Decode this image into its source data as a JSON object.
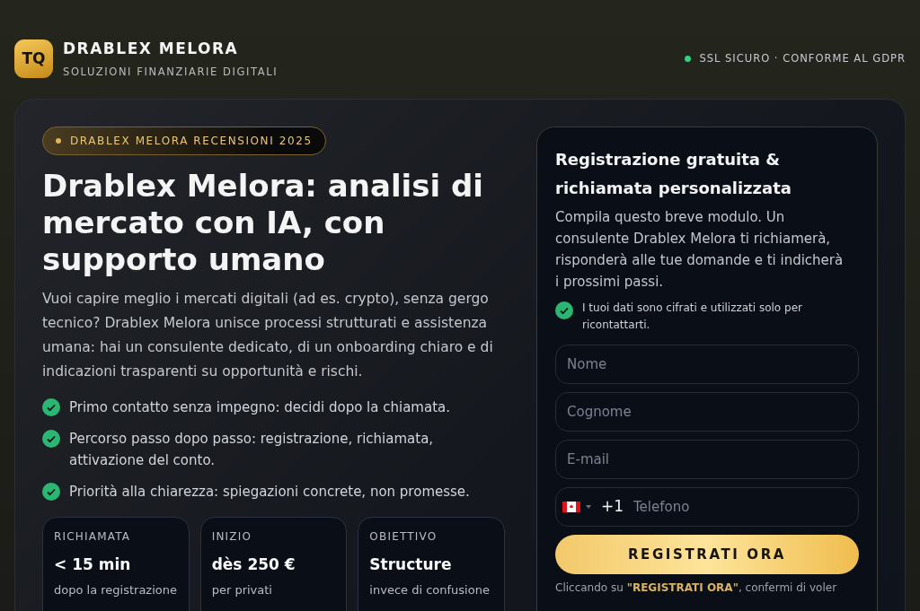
{
  "brand": {
    "logo": "TQ",
    "name": "DRABLEX MELORA",
    "tagline": "SOLUZIONI FINANZIARIE DIGITALI"
  },
  "security": {
    "text": "SSL SICURO · CONFORME AL GDPR"
  },
  "hero": {
    "badge": "DRABLEX MELORA RECENSIONI 2025",
    "title": "Drablex Melora: analisi di mercato con IA, con supporto umano",
    "intro": "Vuoi capire meglio i mercati digitali (ad es. crypto), senza gergo tecnico? Drablex Melora unisce processi strutturati e assistenza umana: hai un consulente dedicato, di un onboarding chiaro e di indicazioni trasparenti su opportunità e rischi.",
    "benefits": [
      "Primo contatto senza impegno: decidi dopo la chiamata.",
      "Percorso passo dopo passo: registrazione, richiamata, attivazione del conto.",
      "Priorità alla chiarezza: spiegazioni concrete, non promesse."
    ],
    "stats": [
      {
        "label": "RICHIAMATA",
        "value": "< 15 min",
        "note": "dopo la registrazione"
      },
      {
        "label": "INIZIO",
        "value": "dès 250 €",
        "note": "per privati"
      },
      {
        "label": "OBIETTIVO",
        "value": "Structure",
        "note": "invece di confusione"
      }
    ]
  },
  "form": {
    "title": "Registrazione gratuita & richiamata personalizzata",
    "description": "Compila questo breve modulo. Un consulente Drablex Melora ti richiamerà, risponderà alle tue domande e ti indicherà i prossimi passi.",
    "privacy_note": "I tuoi dati sono cifrati e utilizzati solo per ricontattarti.",
    "fields": [
      {
        "placeholder": "Nome"
      },
      {
        "placeholder": "Cognome"
      },
      {
        "placeholder": "E-mail"
      }
    ],
    "phone": {
      "dial_code": "+1",
      "placeholder": "Telefono"
    },
    "submit": "REGISTRATI ORA",
    "disclaimer": "Cliccando su **\"REGISTRATI ORA\"**, confermi di voler"
  }
}
